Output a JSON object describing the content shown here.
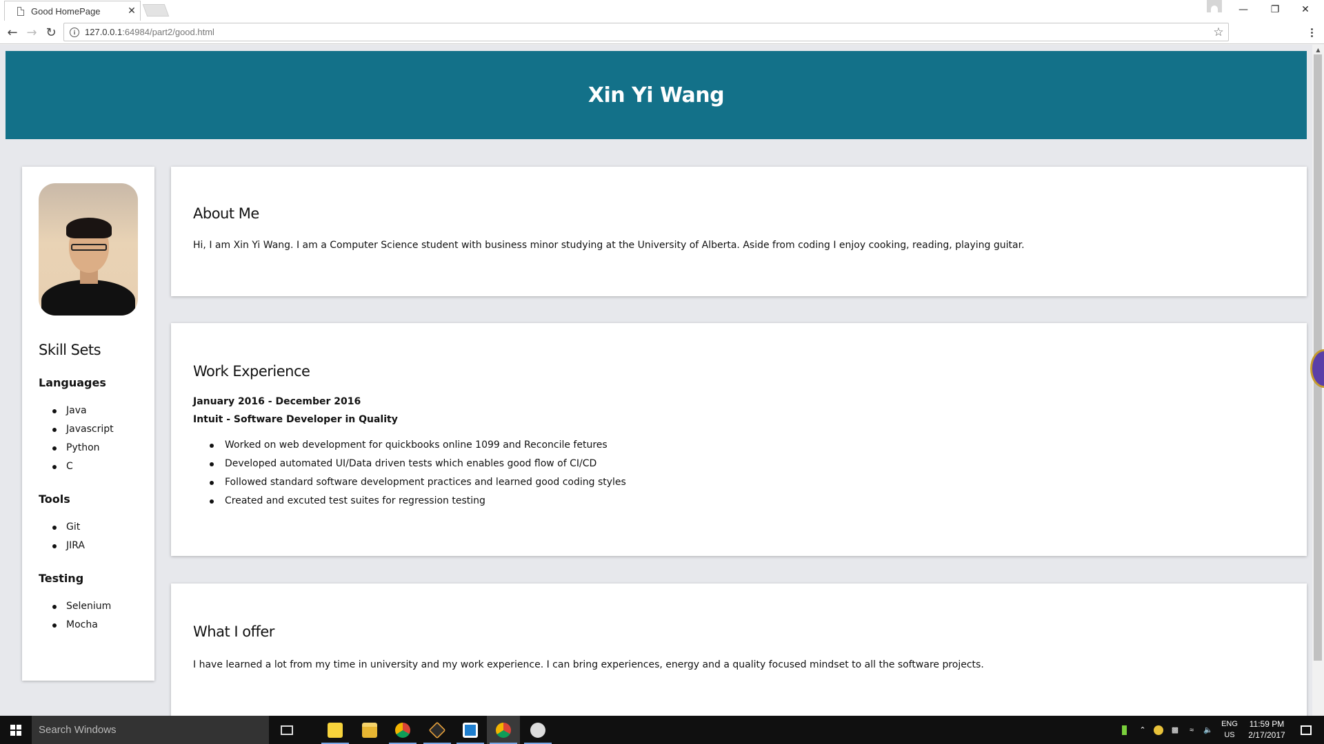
{
  "browser": {
    "tab_title": "Good HomePage",
    "tab_close": "✕",
    "url_host": "127.0.0.1",
    "url_rest": ":64984/part2/good.html"
  },
  "page": {
    "header_name": "Xin Yi Wang",
    "sidebar": {
      "title": "Skill Sets",
      "groups": [
        {
          "label": "Languages",
          "items": [
            "Java",
            "Javascript",
            "Python",
            "C"
          ]
        },
        {
          "label": "Tools",
          "items": [
            "Git",
            "JIRA"
          ]
        },
        {
          "label": "Testing",
          "items": [
            "Selenium",
            "Mocha"
          ]
        }
      ]
    },
    "about": {
      "title": "About Me",
      "text": "Hi, I am Xin Yi Wang. I am a Computer Science student with business minor studying at the University of Alberta. Aside from coding I enjoy cooking, reading, playing guitar."
    },
    "work": {
      "title": "Work Experience",
      "date": "January 2016 - December 2016",
      "role": "Intuit - Software Developer in Quality",
      "bullets": [
        "Worked on web development for quickbooks online 1099 and Reconcile fetures",
        "Developed automated UI/Data driven tests which enables good flow of CI/CD",
        "Followed standard software development practices and learned good coding styles",
        "Created and excuted test suites for regression testing"
      ]
    },
    "offer": {
      "title": "What I offer",
      "text": "I have learned a lot from my time in university and my work experience. I can bring experiences, energy and a quality focused mindset to all the software projects."
    }
  },
  "taskbar": {
    "search_placeholder": "Search Windows",
    "lang_line1": "ENG",
    "lang_line2": "US",
    "time": "11:59 PM",
    "date": "2/17/2017"
  }
}
